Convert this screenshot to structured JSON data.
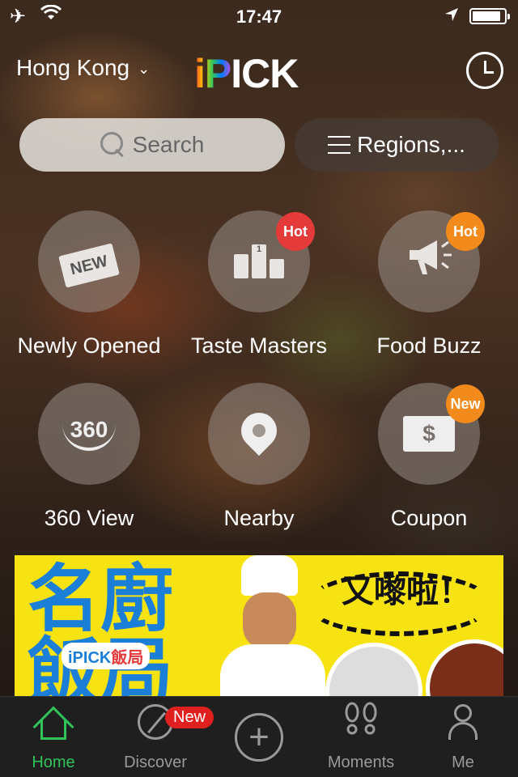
{
  "status_bar": {
    "time": "17:47"
  },
  "header": {
    "city": "Hong Kong",
    "logo_text_ip": "iP",
    "logo_text_rest": "ICK"
  },
  "search": {
    "placeholder": "Search"
  },
  "regions": {
    "label": "Regions,..."
  },
  "grid": [
    {
      "label": "Newly Opened",
      "icon": "new-sign-icon",
      "sign": "NEW"
    },
    {
      "label": "Taste Masters",
      "icon": "podium-icon",
      "badge": "Hot",
      "podium_mark": "1"
    },
    {
      "label": "Food Buzz",
      "icon": "megaphone-icon",
      "badge": "Hot"
    },
    {
      "label": "360 View",
      "icon": "360-view-icon",
      "mark": "360"
    },
    {
      "label": "Nearby",
      "icon": "location-pin-icon"
    },
    {
      "label": "Coupon",
      "icon": "coupon-icon",
      "badge": "New",
      "mark": "$"
    }
  ],
  "banner": {
    "title_zh": "名廚\n飯局",
    "brand": "iPICK",
    "brand_zh": "飯局",
    "headline_zh": "又嚟啦！"
  },
  "tabbar": {
    "tabs": [
      {
        "label": "Home",
        "active": true
      },
      {
        "label": "Discover",
        "badge": "New"
      },
      {
        "label": ""
      },
      {
        "label": "Moments"
      },
      {
        "label": "Me"
      }
    ]
  },
  "colors": {
    "accent_green": "#31c25a",
    "hot_red": "#e53a3a",
    "new_orange": "#f28a1c",
    "banner_yellow": "#f8e312"
  }
}
